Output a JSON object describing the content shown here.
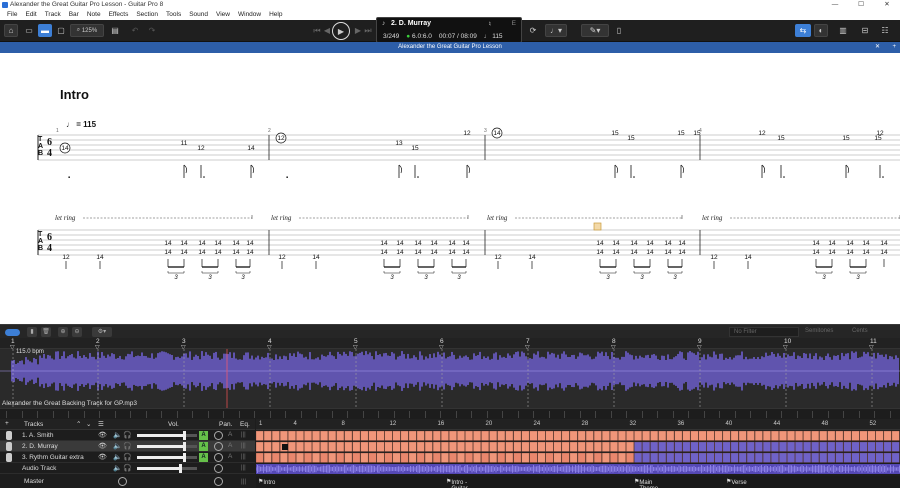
{
  "window": {
    "title": "Alexander the Great Guitar Pro Lesson - Guitar Pro 8"
  },
  "menu": [
    "File",
    "Edit",
    "Track",
    "Bar",
    "Note",
    "Effects",
    "Section",
    "Tools",
    "Sound",
    "View",
    "Window",
    "Help"
  ],
  "toolbar": {
    "zoom": "125%"
  },
  "lcd": {
    "track": "2. D. Murray",
    "bar": "3/249",
    "sig": "6.0:6.0",
    "time": "00:07 / 08:09",
    "tempo": "115",
    "key": "E"
  },
  "doc_tab": {
    "title": "Alexander the Great Guitar Pro Lesson"
  },
  "score": {
    "section": "Intro",
    "tempo": "= 115",
    "let_ring": "let ring",
    "tab_clef": [
      "T",
      "A",
      "B"
    ],
    "time_sig": [
      "6",
      "4"
    ],
    "staff1_frets": [
      "14",
      "11",
      "12",
      "14",
      "12",
      "13",
      "15",
      "12",
      "14",
      "15",
      "15",
      "15",
      "12",
      "15",
      "15",
      "12",
      "15",
      "15",
      "15"
    ],
    "staff2_frets": [
      "12",
      "14",
      "14",
      "14",
      "14",
      "14",
      "14",
      "14",
      "14",
      "14"
    ],
    "triplet": "3",
    "bar_numbers": [
      "1",
      "2",
      "3",
      "4"
    ]
  },
  "bottom_toolbar": {
    "filter_placeholder": "No Filter",
    "semitones": "Semitones",
    "cents": "Cents"
  },
  "timeline": {
    "bpm": "115.0 bpm",
    "bars": [
      "1",
      "2",
      "3",
      "4",
      "5",
      "6",
      "7",
      "8",
      "9",
      "10",
      "11"
    ]
  },
  "audio": {
    "caption": "Alexander the Great Backing Track for GP.mp3"
  },
  "tracks_panel": {
    "header": "Tracks",
    "vol_label": "Vol.",
    "pan_label": "Pan.",
    "eq_label": "Eq.",
    "bar_numbers": [
      "1",
      "4",
      "8",
      "12",
      "16",
      "20",
      "24",
      "28",
      "32",
      "36",
      "40",
      "44",
      "48",
      "52"
    ],
    "rows": [
      {
        "name": "1. A. Smith",
        "vol": 0.78
      },
      {
        "name": "2. D. Murray",
        "vol": 0.78
      },
      {
        "name": "3. Rythm Guitar extra",
        "vol": 0.78
      },
      {
        "name": "Audio Track",
        "vol": 0.72
      }
    ],
    "master": "Master",
    "markers": [
      "Intro",
      "Intro - Guitar Solo",
      "Main Theme",
      "Verse"
    ]
  },
  "colors": {
    "accent": "#3d7fd6",
    "clip": "#f0967a",
    "audio": "#7b6fd6",
    "rest_clip": "#6f62c8"
  }
}
